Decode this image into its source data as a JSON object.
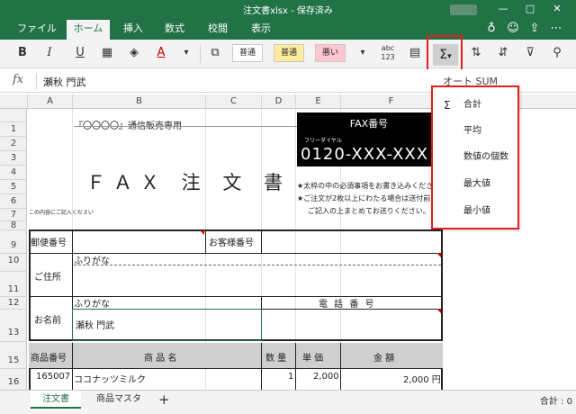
{
  "title": {
    "doc": "注文書xlsx - 保存済み"
  },
  "menu": {
    "file": "ファイル",
    "home": "ホーム",
    "insert": "挿入",
    "formulas": "数式",
    "review": "校閲",
    "view": "表示"
  },
  "ribbon": {
    "bold": "B",
    "italic": "I",
    "underline": "U",
    "font_color": "A",
    "style_normal": "普通",
    "style_bad": "悪い",
    "style_good": "良い",
    "style_neutral": "普通",
    "number_format": "abc 123",
    "sum": "Σ"
  },
  "formula_bar": {
    "fx": "fx",
    "value": "瀬秋 門武",
    "hint": "オート SUM"
  },
  "columns": [
    "A",
    "B",
    "C",
    "D",
    "E",
    "F"
  ],
  "rows": [
    "1",
    "2",
    "3",
    "4",
    "5",
    "6",
    "7",
    "8",
    "9",
    "10",
    "11",
    "12",
    "13",
    "15",
    "16"
  ],
  "sheet": {
    "store": "『〇〇〇〇』通信販売専用",
    "heading": "ＦＡＸ 注 文 書",
    "please_fill": "この内容にご記入ください",
    "fax_title": "FAX番号",
    "fax_small": "フリーダイヤル",
    "fax_number": "0120-XXX-XXX",
    "note1": "★太枠の中の必須事項をお書き込みください",
    "note2": "★ご注文が2枚以上にわたる場合は送付前に",
    "note3": "ご記入の上まとめてお送りください。",
    "postal": "郵便番号",
    "customer_no": "お客様番号",
    "address": "ご住所",
    "furigana1": "ふりがな",
    "furigana2": "ふりがな",
    "phone": "電 話 番 号",
    "name": "お名前",
    "name_value": "瀬秋 門武",
    "table_headers": [
      "商品番号",
      "商 品 名",
      "数 量",
      "単 価",
      "金 額"
    ],
    "rows": [
      {
        "code": "165007",
        "product": "ココナッツミルク",
        "qty": "1",
        "price": "2,000",
        "amount": "2,000 円"
      }
    ]
  },
  "dropdown": {
    "items": [
      {
        "icon": "Σ",
        "label": "合計"
      },
      {
        "icon": "",
        "label": "平均"
      },
      {
        "icon": "",
        "label": "数値の個数"
      },
      {
        "icon": "",
        "label": "最大値"
      },
      {
        "icon": "",
        "label": "最小値"
      }
    ]
  },
  "tabs": {
    "sheet1": "注文書",
    "sheet2": "商品マスタ",
    "add": "+"
  },
  "status": {
    "sum": "合計 : 0"
  }
}
